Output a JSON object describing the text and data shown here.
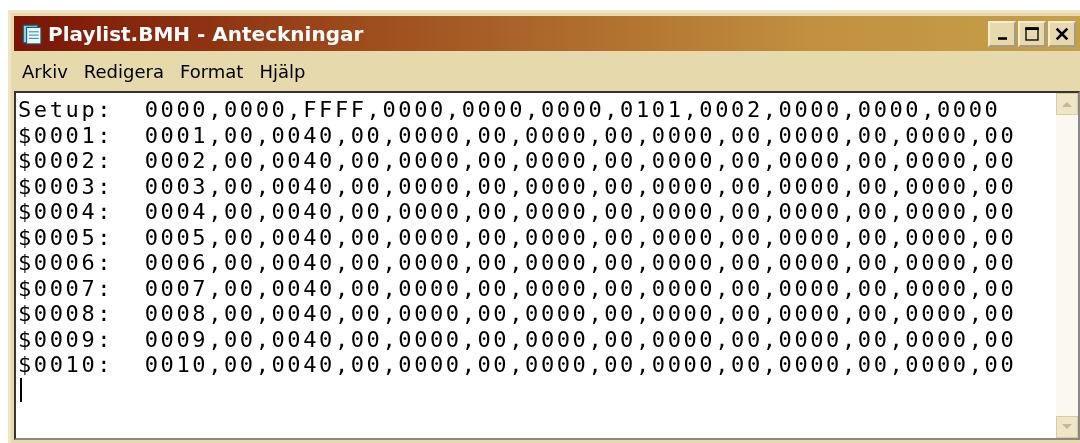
{
  "window": {
    "title": "Playlist.BMH - Anteckningar"
  },
  "menu": [
    "Arkiv",
    "Redigera",
    "Format",
    "Hjälp"
  ],
  "editor": {
    "lines": [
      "Setup:  0000,0000,FFFF,0000,0000,0000,0101,0002,0000,0000,0000",
      "$0001:  0001,00,0040,00,0000,00,0000,00,0000,00,0000,00,0000,00",
      "$0002:  0002,00,0040,00,0000,00,0000,00,0000,00,0000,00,0000,00",
      "$0003:  0003,00,0040,00,0000,00,0000,00,0000,00,0000,00,0000,00",
      "$0004:  0004,00,0040,00,0000,00,0000,00,0000,00,0000,00,0000,00",
      "$0005:  0005,00,0040,00,0000,00,0000,00,0000,00,0000,00,0000,00",
      "$0006:  0006,00,0040,00,0000,00,0000,00,0000,00,0000,00,0000,00",
      "$0007:  0007,00,0040,00,0000,00,0000,00,0000,00,0000,00,0000,00",
      "$0008:  0008,00,0040,00,0000,00,0000,00,0000,00,0000,00,0000,00",
      "$0009:  0009,00,0040,00,0000,00,0000,00,0000,00,0000,00,0000,00",
      "$0010:  0010,00,0040,00,0000,00,0000,00,0000,00,0000,00,0000,00"
    ]
  }
}
